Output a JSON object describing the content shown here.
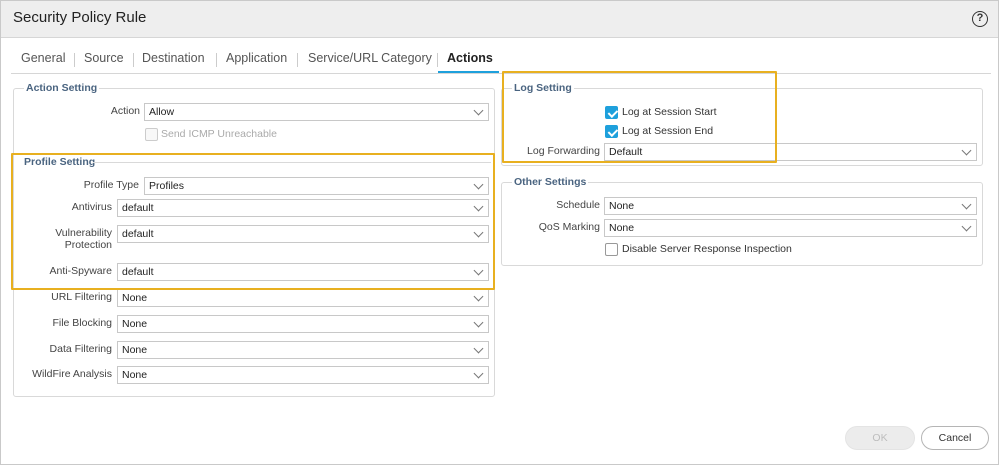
{
  "dialog": {
    "title": "Security Policy Rule"
  },
  "tabs": [
    {
      "label": "General"
    },
    {
      "label": "Source"
    },
    {
      "label": "Destination"
    },
    {
      "label": "Application"
    },
    {
      "label": "Service/URL Category"
    },
    {
      "label": "Actions",
      "active": true
    }
  ],
  "action_setting": {
    "legend": "Action Setting",
    "action_label": "Action",
    "action_value": "Allow",
    "icmp_label": "Send ICMP Unreachable"
  },
  "profile_setting": {
    "legend": "Profile Setting",
    "rows": [
      {
        "label": "Profile Type",
        "value": "Profiles"
      },
      {
        "label": "Antivirus",
        "value": "default"
      },
      {
        "label": "Vulnerability Protection",
        "value": "default"
      },
      {
        "label": "Anti-Spyware",
        "value": "default"
      },
      {
        "label": "URL Filtering",
        "value": "None"
      },
      {
        "label": "File Blocking",
        "value": "None"
      },
      {
        "label": "Data Filtering",
        "value": "None"
      },
      {
        "label": "WildFire Analysis",
        "value": "None"
      }
    ]
  },
  "log_setting": {
    "legend": "Log Setting",
    "session_start_label": "Log at Session Start",
    "session_end_label": "Log at Session End",
    "forwarding_label": "Log Forwarding",
    "forwarding_value": "Default"
  },
  "other_settings": {
    "legend": "Other Settings",
    "schedule_label": "Schedule",
    "schedule_value": "None",
    "qos_label": "QoS Marking",
    "qos_value": "None",
    "dsri_label": "Disable Server Response Inspection"
  },
  "footer": {
    "ok_label": "OK",
    "cancel_label": "Cancel"
  },
  "colors": {
    "accent": "#1ea0dc",
    "highlight": "#e8b020"
  }
}
